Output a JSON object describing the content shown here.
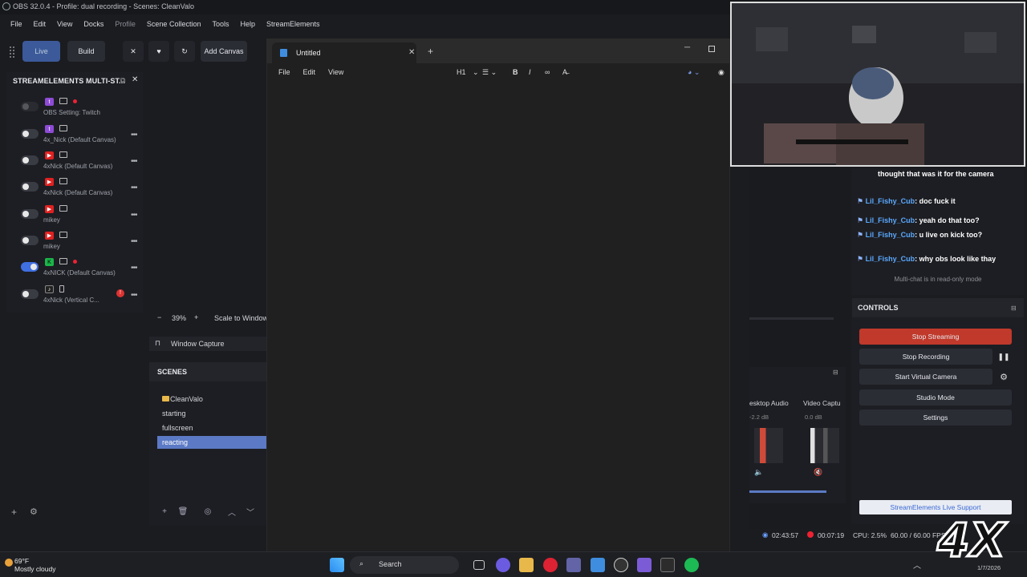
{
  "window": {
    "title": "OBS 32.0.4 - Profile: dual recording - Scenes: CleanValo"
  },
  "menu": [
    "File",
    "Edit",
    "View",
    "Docks",
    "Profile",
    "Scene Collection",
    "Tools",
    "Help",
    "StreamElements"
  ],
  "toolbar": {
    "live": "Live",
    "build": "Build",
    "add_canvas": "Add Canvas"
  },
  "multistream": {
    "title": "STREAMELEMENTS MULTI-ST...",
    "rows": [
      {
        "label": "OBS Setting: Twitch",
        "platform": "T",
        "state": "dim"
      },
      {
        "label": "4x_Nick (Default Canvas)",
        "platform": "T",
        "state": "off"
      },
      {
        "label": "4xNick (Default Canvas)",
        "platform": "Y",
        "state": "off"
      },
      {
        "label": "4xNick (Default Canvas)",
        "platform": "Y",
        "state": "off"
      },
      {
        "label": "mikey",
        "platform": "Y",
        "state": "off"
      },
      {
        "label": "mikey",
        "platform": "Y",
        "state": "off"
      },
      {
        "label": "4xNICK (Default Canvas)",
        "platform": "K",
        "state": "on"
      },
      {
        "label": "4xNick (Vertical C...",
        "platform": "TT",
        "state": "off"
      }
    ]
  },
  "preview": {
    "zoom": "39%",
    "scale": "Scale to Window",
    "source": "Window Capture"
  },
  "scenes": {
    "title": "SCENES",
    "items": [
      "CleanValo",
      "starting",
      "fullscreen",
      "reacting"
    ],
    "selected": 3
  },
  "notepad": {
    "tab_title": "Untitled",
    "menu": [
      "File",
      "Edit",
      "View"
    ],
    "heading": "H1"
  },
  "chat": {
    "lines": [
      {
        "user": "",
        "text": "thought that was it for the camera"
      },
      {
        "user": "Lil_Fishy_Cub",
        "text": "doc fuck it"
      },
      {
        "user": "Lil_Fishy_Cub",
        "text": "yeah do that too?"
      },
      {
        "user": "Lil_Fishy_Cub",
        "text": "u live on kick too?"
      },
      {
        "user": "Lil_Fishy_Cub",
        "text": "why obs look like thay"
      }
    ],
    "readonly": "Multi-chat is in read-only mode"
  },
  "controls": {
    "title": "CONTROLS",
    "stop_streaming": "Stop Streaming",
    "stop_recording": "Stop Recording",
    "start_virtual_camera": "Start Virtual Camera",
    "studio_mode": "Studio Mode",
    "settings": "Settings",
    "se_live": "StreamElements Live Support"
  },
  "audio": {
    "ch1": "esktop Audio",
    "ch1_db": "-2.2 dB",
    "ch2": "Video Captu",
    "ch2_db": "0.0 dB"
  },
  "status": {
    "stream_time": "02:43:57",
    "rec_time": "00:07:19",
    "cpu": "CPU: 2.5%",
    "fps": "60.00 / 60.00 FPS"
  },
  "taskbar": {
    "temp": "69°F",
    "weather": "Mostly cloudy",
    "search": "Search",
    "date": "1/7/2026"
  },
  "logo": "4X"
}
